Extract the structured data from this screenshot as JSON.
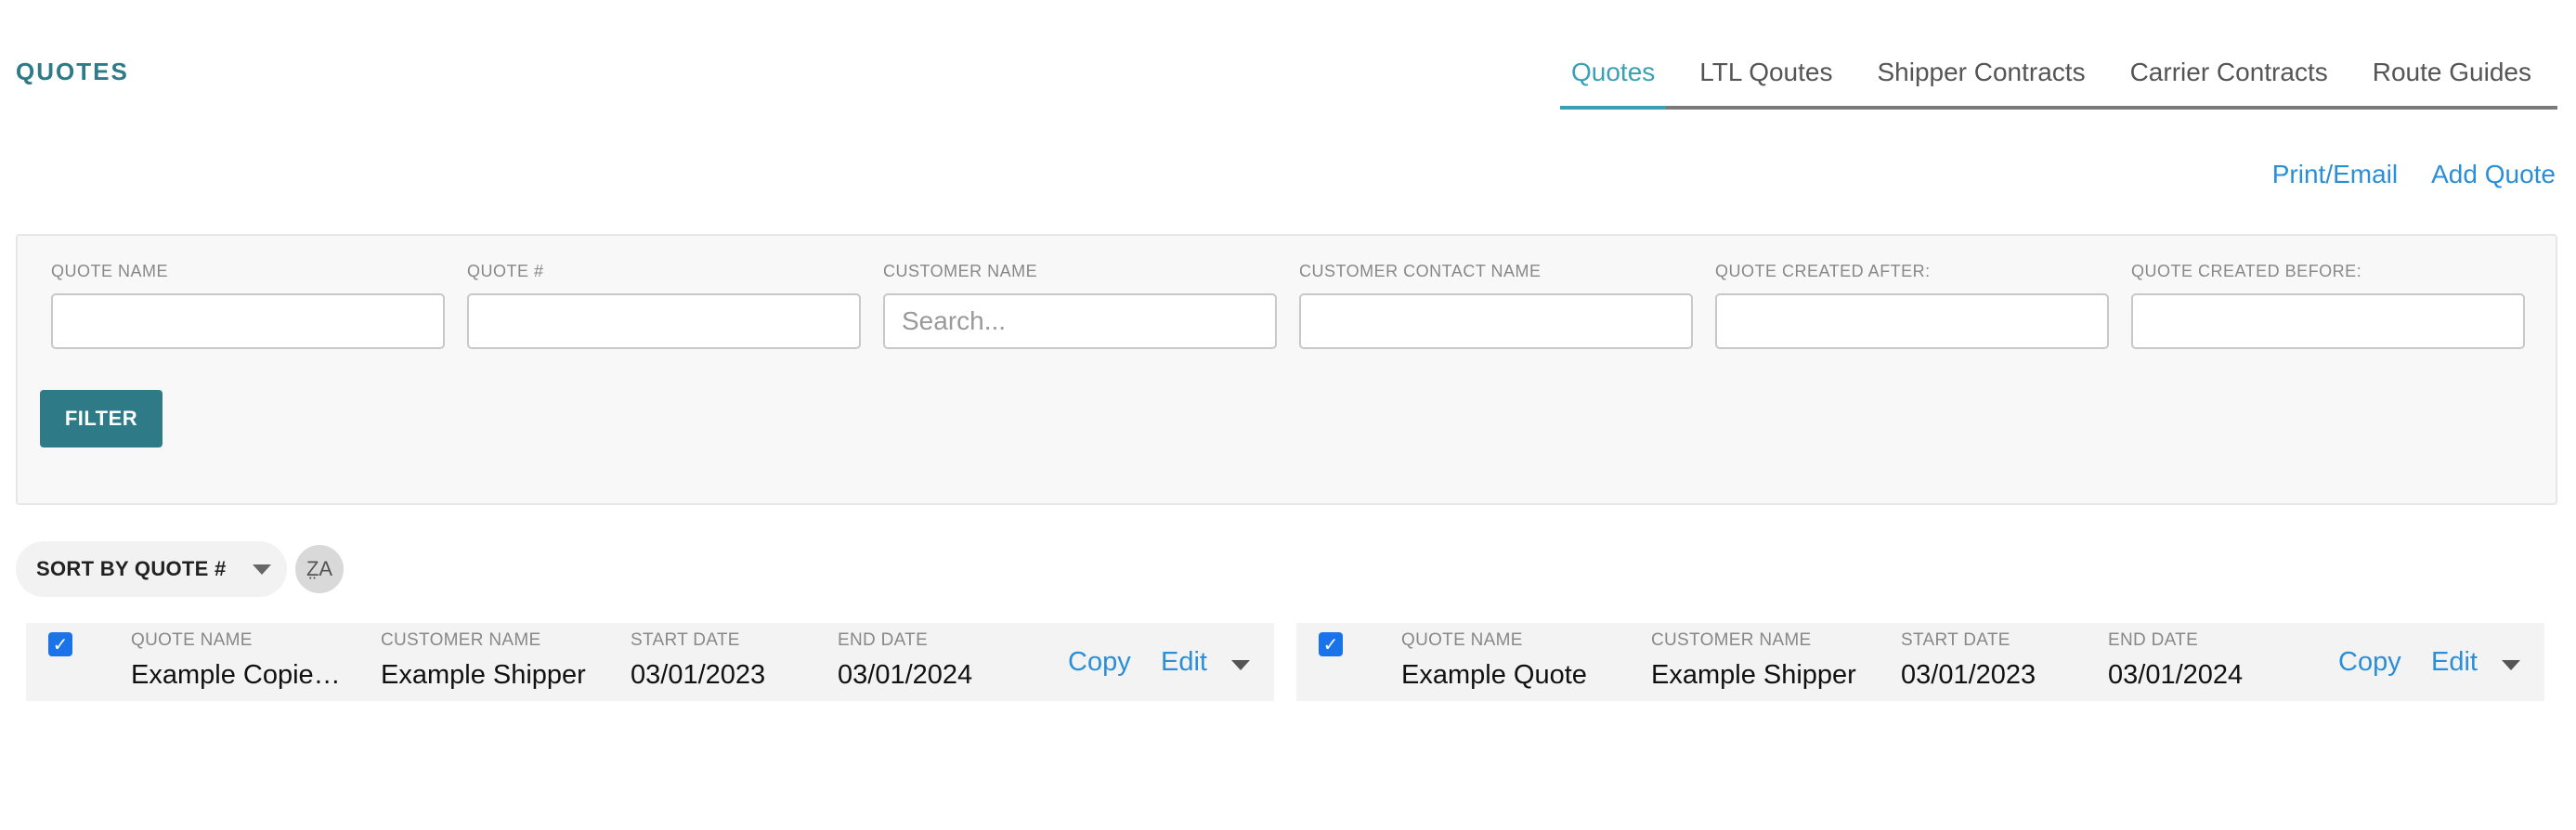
{
  "header": {
    "title": "QUOTES",
    "tabs": [
      {
        "label": "Quotes",
        "active": true
      },
      {
        "label": "LTL Qoutes",
        "active": false
      },
      {
        "label": "Shipper Contracts",
        "active": false
      },
      {
        "label": "Carrier Contracts",
        "active": false
      },
      {
        "label": "Route Guides",
        "active": false
      }
    ]
  },
  "actions": {
    "print_email": "Print/Email",
    "add_quote": "Add Quote"
  },
  "filters": {
    "quote_name": {
      "label": "QUOTE NAME",
      "value": "",
      "placeholder": ""
    },
    "quote_number": {
      "label": "QUOTE #",
      "value": "",
      "placeholder": ""
    },
    "customer_name": {
      "label": "CUSTOMER NAME",
      "value": "",
      "placeholder": "Search..."
    },
    "customer_contact": {
      "label": "CUSTOMER CONTACT NAME",
      "value": "",
      "placeholder": ""
    },
    "created_after": {
      "label": "QUOTE CREATED AFTER:",
      "value": "",
      "placeholder": ""
    },
    "created_before": {
      "label": "QUOTE CREATED BEFORE:",
      "value": "",
      "placeholder": ""
    },
    "filter_button": "FILTER"
  },
  "sort": {
    "label": "SORT BY QUOTE #",
    "direction_icon": "sort-az-icon",
    "direction_glyph": "Z̤A"
  },
  "columns": {
    "quote_name": "QUOTE NAME",
    "customer_name": "CUSTOMER NAME",
    "start_date": "START DATE",
    "end_date": "END DATE"
  },
  "quotes": [
    {
      "checked": true,
      "quote_name": "Example Copied Quote",
      "customer_name": "Example Shipper",
      "start_date": "03/01/2023",
      "end_date": "03/01/2024",
      "copy_label": "Copy",
      "edit_label": "Edit"
    },
    {
      "checked": true,
      "quote_name": "Example Quote",
      "customer_name": "Example Shipper",
      "start_date": "03/01/2023",
      "end_date": "03/01/2024",
      "copy_label": "Copy",
      "edit_label": "Edit"
    }
  ]
}
